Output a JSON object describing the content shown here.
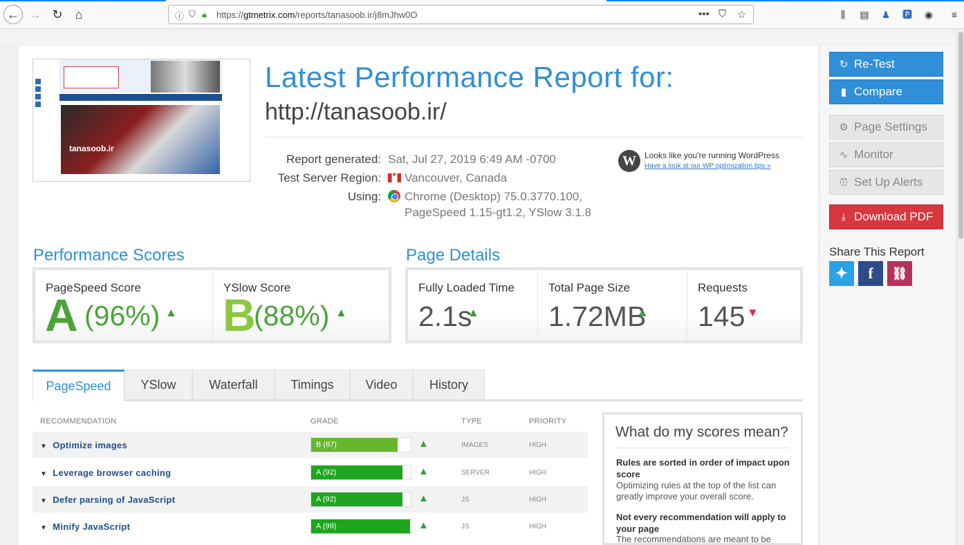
{
  "browser": {
    "url_prefix": "https://",
    "url_domain": "gtmetrix.com",
    "url_path": "/reports/tanasoob.ir/j8mJhw0O",
    "more_glyph": "•••"
  },
  "thumbnail": {
    "site_label": "tanasoob.ir"
  },
  "report": {
    "title": "Latest Performance Report for:",
    "url": "http://tanasoob.ir/",
    "generated_label": "Report generated:",
    "generated_value": "Sat, Jul 27, 2019 6:49 AM -0700",
    "region_label": "Test Server Region:",
    "region_value": "Vancouver, Canada",
    "using_label": "Using:",
    "using_value_1": "Chrome (Desktop) 75.0.3770.100,",
    "using_value_2": "PageSpeed 1.15-gt1.2, YSlow 3.1.8"
  },
  "wordpress": {
    "text": "Looks like you're running WordPress",
    "link": "Have a look at our WP optimization tips »"
  },
  "performance": {
    "heading": "Performance Scores",
    "pagespeed_label": "PageSpeed Score",
    "pagespeed_grade": "A",
    "pagespeed_pct": "(96%)",
    "yslow_label": "YSlow Score",
    "yslow_grade": "B",
    "yslow_pct": "(88%)"
  },
  "details": {
    "heading": "Page Details",
    "loaded_label": "Fully Loaded Time",
    "loaded_value": "2.1s",
    "size_label": "Total Page Size",
    "size_value": "1.72MB",
    "requests_label": "Requests",
    "requests_value": "145"
  },
  "tabs": [
    "PageSpeed",
    "YSlow",
    "Waterfall",
    "Timings",
    "Video",
    "History"
  ],
  "table": {
    "columns": [
      "RECOMMENDATION",
      "GRADE",
      "TYPE",
      "PRIORITY"
    ],
    "rows": [
      {
        "name": "Optimize images",
        "grade": "B (87)",
        "score": 87,
        "type": "IMAGES",
        "priority": "HIGH"
      },
      {
        "name": "Leverage browser caching",
        "grade": "A (92)",
        "score": 92,
        "type": "SERVER",
        "priority": "HIGH"
      },
      {
        "name": "Defer parsing of JavaScript",
        "grade": "A (92)",
        "score": 92,
        "type": "JS",
        "priority": "HIGH"
      },
      {
        "name": "Minify JavaScript",
        "grade": "A (99)",
        "score": 99,
        "type": "JS",
        "priority": "HIGH"
      }
    ]
  },
  "explain": {
    "title": "What do my scores mean?",
    "b1": "Rules are sorted in order of impact upon score",
    "t1": "Optimizing rules at the top of the list can greatly improve your overall score.",
    "b2": "Not every recommendation will apply to your page",
    "t2": "The recommendations are meant to be"
  },
  "sidebar": {
    "retest": "Re-Test",
    "compare": "Compare",
    "settings": "Page Settings",
    "monitor": "Monitor",
    "alerts": "Set Up Alerts",
    "pdf": "Download PDF",
    "share": "Share This Report"
  },
  "colors": {
    "accent": "#2f8fd8",
    "grade_a": "#4aa43a",
    "grade_b": "#8dc63f",
    "pdf": "#d9363e"
  }
}
